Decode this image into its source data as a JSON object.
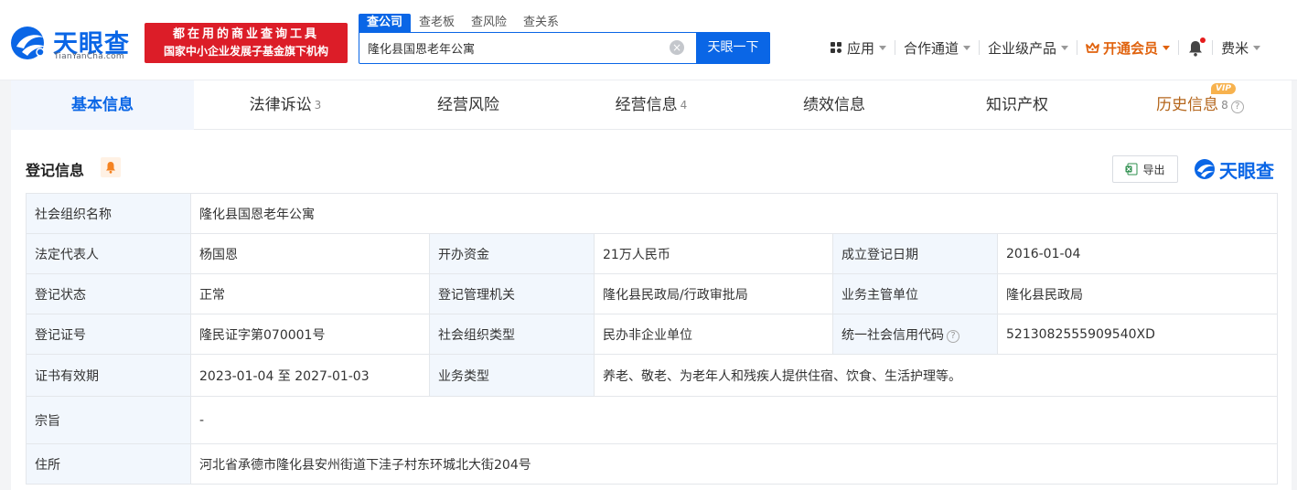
{
  "brand": {
    "name": "天眼查",
    "domain": "TianYanCha.com"
  },
  "slogan": {
    "line1": "都在用的商业查询工具",
    "line2": "国家中小企业发展子基金旗下机构"
  },
  "search": {
    "tabs": [
      "查公司",
      "查老板",
      "查风险",
      "查关系"
    ],
    "value": "隆化县国恩老年公寓",
    "button": "天眼一下"
  },
  "topnav": {
    "app": "应用",
    "channel": "合作通道",
    "enterprise": "企业级产品",
    "vip": "开通会员",
    "user": "费米"
  },
  "tabs": [
    {
      "label": "基本信息",
      "count": ""
    },
    {
      "label": "法律诉讼",
      "count": "3"
    },
    {
      "label": "经营风险",
      "count": ""
    },
    {
      "label": "经营信息",
      "count": "4"
    },
    {
      "label": "绩效信息",
      "count": ""
    },
    {
      "label": "知识产权",
      "count": ""
    },
    {
      "label": "历史信息",
      "count": "8",
      "badge": "VIP"
    }
  ],
  "section": {
    "title": "登记信息",
    "export": "导出",
    "brand": "天眼查"
  },
  "info": {
    "org_name_label": "社会组织名称",
    "org_name": "隆化县国恩老年公寓",
    "legal_rep_label": "法定代表人",
    "legal_rep": "杨国恩",
    "capital_label": "开办资金",
    "capital": "21万人民币",
    "reg_date_label": "成立登记日期",
    "reg_date": "2016-01-04",
    "status_label": "登记状态",
    "status": "正常",
    "authority_label": "登记管理机关",
    "authority": "隆化县民政局/行政审批局",
    "supervisor_label": "业务主管单位",
    "supervisor": "隆化县民政局",
    "cert_no_label": "登记证号",
    "cert_no": "隆民证字第070001号",
    "org_type_label": "社会组织类型",
    "org_type": "民办非企业单位",
    "credit_code_label": "统一社会信用代码",
    "credit_code": "5213082555909540XD",
    "validity_label": "证书有效期",
    "validity": "2023-01-04 至 2027-01-03",
    "biz_type_label": "业务类型",
    "biz_type": "养老、敬老、为老年人和残疾人提供住宿、饮食、生活护理等。",
    "purpose_label": "宗旨",
    "purpose": "-",
    "address_label": "住所",
    "address": "河北省承德市隆化县安州街道下洼子村东环城北大街204号"
  },
  "colors": {
    "accent": "#0a66e6",
    "slogan_bg": "#dc1d28",
    "vip": "#e0620d",
    "status_ok": "#18a058"
  }
}
